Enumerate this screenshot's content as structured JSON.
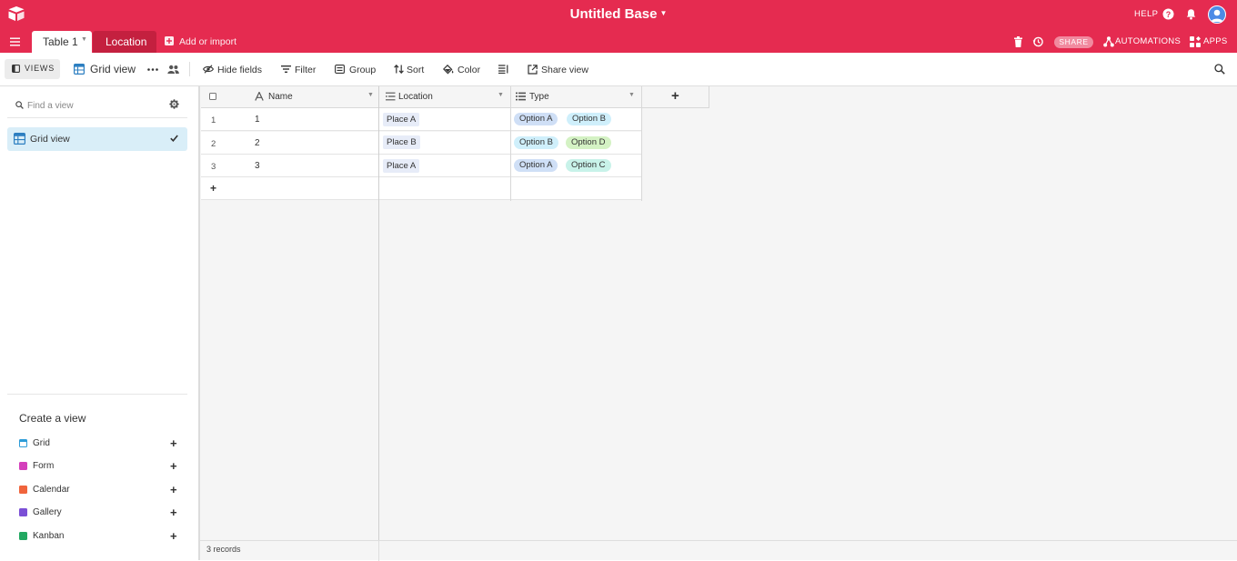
{
  "header": {
    "base_title": "Untitled Base",
    "help_label": "HELP",
    "share_label": "SHARE",
    "automations_label": "AUTOMATIONS",
    "apps_label": "APPS",
    "brand_color": "#e52b50"
  },
  "tabs": [
    {
      "label": "Table 1",
      "active": true
    },
    {
      "label": "Location",
      "active": false
    }
  ],
  "add_import_label": "Add or import",
  "toolbar": {
    "views_label": "VIEWS",
    "current_view": "Grid view",
    "hide_fields": "Hide fields",
    "filter": "Filter",
    "group": "Group",
    "sort": "Sort",
    "color": "Color",
    "share_view": "Share view"
  },
  "sidebar": {
    "find_placeholder": "Find a view",
    "views": [
      {
        "label": "Grid view",
        "selected": true
      }
    ],
    "create_title": "Create a view",
    "create_items": [
      {
        "label": "Grid",
        "color": "#2d9cd8"
      },
      {
        "label": "Form",
        "color": "#d43fbb"
      },
      {
        "label": "Calendar",
        "color": "#f0643c"
      },
      {
        "label": "Gallery",
        "color": "#7b4fd6"
      },
      {
        "label": "Kanban",
        "color": "#22a861"
      }
    ]
  },
  "grid": {
    "columns": [
      "Name",
      "Location",
      "Type"
    ],
    "rows": [
      {
        "num": "1",
        "name": "1",
        "location": "Place A",
        "types": [
          "Option A",
          "Option B"
        ]
      },
      {
        "num": "2",
        "name": "2",
        "location": "Place B",
        "types": [
          "Option B",
          "Option D"
        ]
      },
      {
        "num": "3",
        "name": "3",
        "location": "Place A",
        "types": [
          "Option A",
          "Option C"
        ]
      }
    ],
    "option_colors": {
      "Option A": "#cfdff6",
      "Option B": "#cfeffb",
      "Option C": "#c8f2e9",
      "Option D": "#d4f2c4"
    },
    "add_row_symbol": "+",
    "add_column_symbol": "+",
    "record_count": "3 records"
  }
}
